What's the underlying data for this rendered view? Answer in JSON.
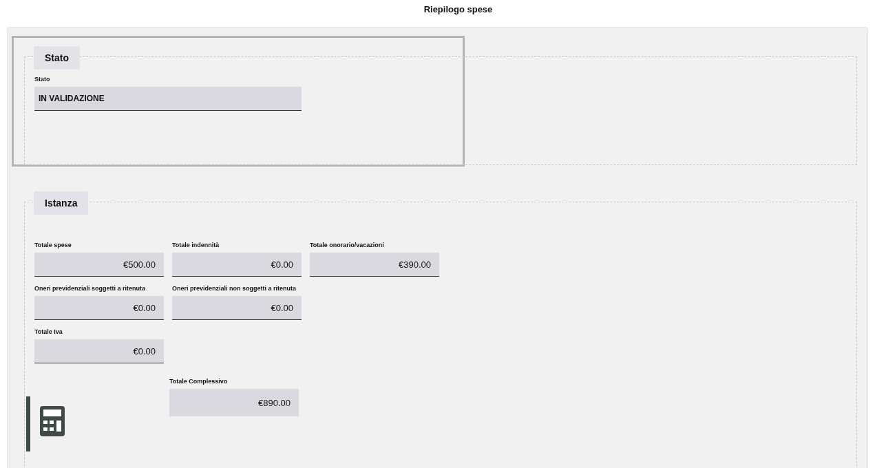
{
  "title": "Riepilogo spese",
  "stato": {
    "legend": "Stato",
    "fields": [
      {
        "label": "Stato",
        "value": "IN VALIDAZIONE"
      }
    ]
  },
  "istanza": {
    "legend": "Istanza",
    "rows": [
      [
        {
          "label": "Totale spese",
          "value": "€500.00"
        },
        {
          "label": "Totale indennità",
          "value": "€0.00"
        },
        {
          "label": "Totale onorario/vacazioni",
          "value": "€390.00"
        }
      ],
      [
        {
          "label": "Oneri previdenziali soggetti a ritenuta",
          "value": "€0.00"
        },
        {
          "label": "Oneri previdenziali non soggetti a ritenuta",
          "value": "€0.00"
        }
      ],
      [
        {
          "label": "Totale Iva",
          "value": "€0.00"
        }
      ]
    ],
    "total": {
      "label": "Totale Complessivo",
      "value": "€890.00"
    }
  }
}
